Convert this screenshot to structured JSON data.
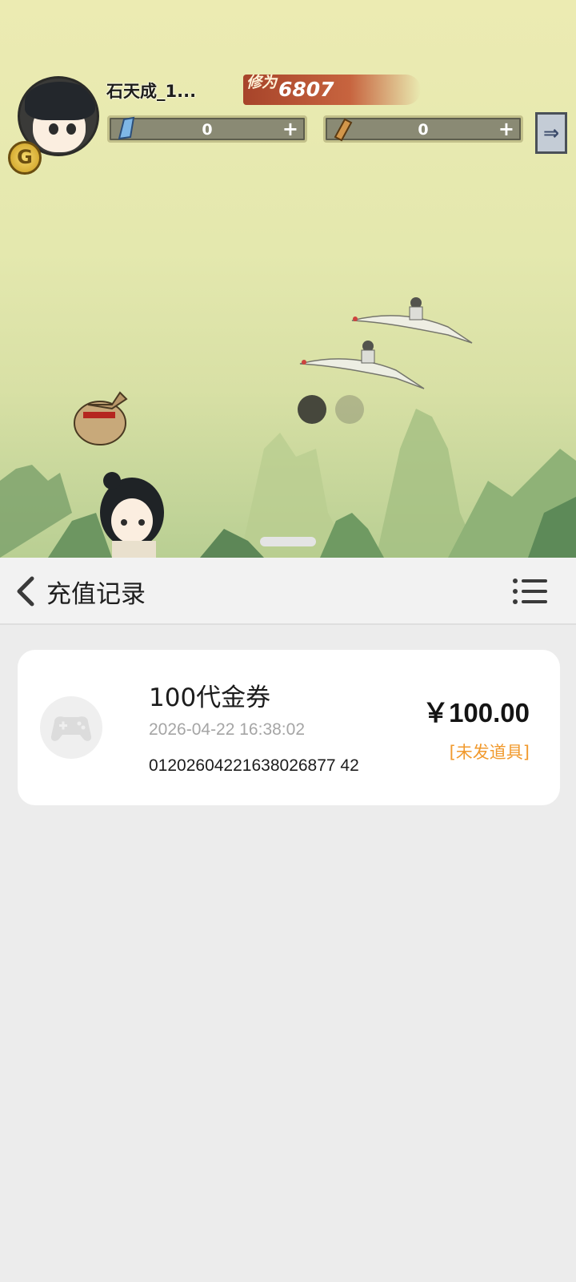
{
  "game": {
    "player_name": "石天成_1...",
    "level_badge": "G",
    "cultivation_label": "修为",
    "cultivation_value": "6807",
    "resources": [
      {
        "icon": "crystal-icon",
        "value": "0",
        "plus": "+"
      },
      {
        "icon": "scroll-icon",
        "value": "0",
        "plus": "+"
      }
    ],
    "expand_glyph": "⇒"
  },
  "page": {
    "title": "充值记录",
    "back_icon": "chevron-left-icon",
    "menu_icon": "list-menu-icon"
  },
  "records": [
    {
      "icon": "gamepad-icon",
      "name": "100代金券",
      "time": "2026-04-22 16:38:02",
      "order_no": "01202604221638026877 42",
      "price": "￥100.00",
      "status": "[未发道具]"
    }
  ],
  "colors": {
    "status": "#f19a2e",
    "sheet_bg": "#ececec"
  }
}
